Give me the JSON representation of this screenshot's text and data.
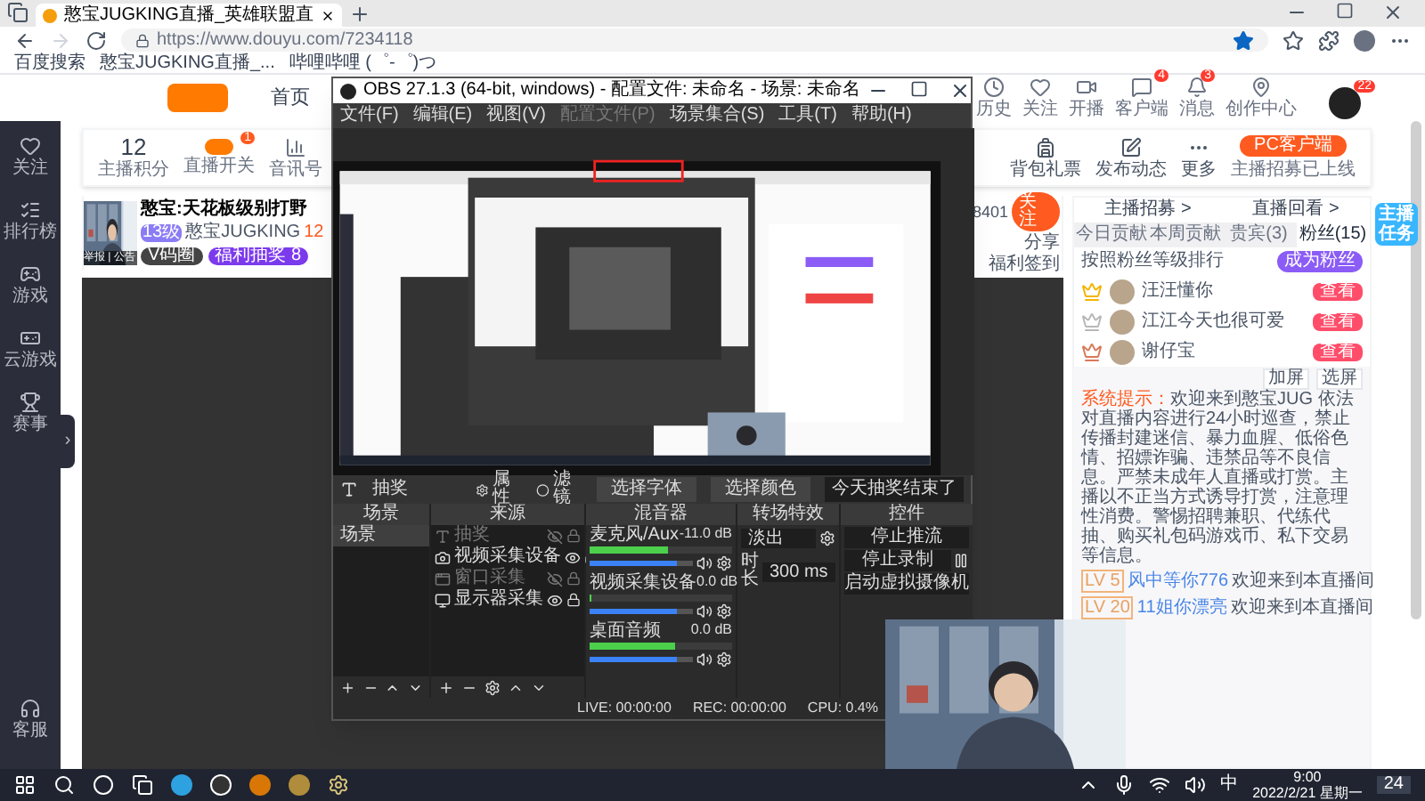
{
  "browser": {
    "tab_title": "憨宝JUGKING直播_英雄联盟直",
    "url": "https://www.douyu.com/7234118",
    "bookmarks": [
      "百度搜索",
      "憨宝JUGKING直播_...",
      "哔哩哔哩 (゜-゜)つ"
    ]
  },
  "sidebar": {
    "items": [
      "关注",
      "排行榜",
      "游戏",
      "云游戏",
      "赛事"
    ],
    "bottom": "客服",
    "toggle": "›"
  },
  "header": {
    "nav": "首页",
    "icons": [
      {
        "label": "历史"
      },
      {
        "label": "关注"
      },
      {
        "label": "开播"
      },
      {
        "label": "客户端",
        "badge": "4"
      },
      {
        "label": "消息",
        "badge": "3"
      },
      {
        "label": "创作中心"
      }
    ],
    "avatar_badge": "22"
  },
  "stats": {
    "score": "12",
    "score_label": "主播积分",
    "switch_label": "直播开关",
    "switch_badge": "1",
    "signal_label": "音讯号",
    "tools": [
      "背包礼票",
      "发布动态",
      "更多"
    ],
    "pc_button": "PC客户端",
    "pc_note": "主播招募已上线"
  },
  "streamer": {
    "thumb_overlay": "举报 | 公告",
    "title": "憨宝:天花板级别打野",
    "level": "13级",
    "name": "憨宝JUGKING",
    "heat": "12",
    "tags": [
      "V码圈",
      "福利抽奖 8"
    ],
    "followers": "8401",
    "follow_button": "关注",
    "share": "分享",
    "sign": "福利签到"
  },
  "panel": {
    "links": [
      "主播招募 >",
      "直播回看 >"
    ],
    "tabs": [
      {
        "label": "今日贡献",
        "selected": false
      },
      {
        "label": "本周贡献",
        "selected": false
      },
      {
        "label": "贵宾(3)",
        "selected": false
      },
      {
        "label": "粉丝(15)",
        "selected": true
      }
    ],
    "rank_title": "按照粉丝等级排行",
    "join_button": "成为粉丝",
    "fans": [
      {
        "name": "汪汪懂你",
        "badge": "查看"
      },
      {
        "name": "江江今天也很可爱",
        "badge": "查看"
      },
      {
        "name": "谢仔宝",
        "badge": "查看"
      }
    ],
    "system_label": "系统提示：",
    "system_text": "欢迎来到憨宝JUG 依法对直播内容进行24小时巡查，禁止传播封建迷信、暴力血腥、低俗色情、招嫖诈骗、违禁品等不良信息。严禁未成年人直播或打赏。主播以不正当方式诱导打赏，注意理性消费。警惕招聘兼职、代练代抽、购买礼包码游戏币、私下交易等信息。",
    "chat_tools": [
      "加屏",
      "选屏"
    ],
    "messages": [
      {
        "level": "LV 5",
        "name": "风中等你776",
        "text": "欢迎来到本直播间"
      },
      {
        "level": "LV 20",
        "name": "11姐你漂亮",
        "text": "欢迎来到本直播间"
      }
    ]
  },
  "sticker": "主播任务",
  "obs": {
    "title": "OBS 27.1.3 (64-bit, windows) - 配置文件: 未命名 - 场景: 未命名",
    "menu": [
      {
        "label": "文件(F)",
        "disabled": false
      },
      {
        "label": "编辑(E)",
        "disabled": false
      },
      {
        "label": "视图(V)",
        "disabled": false
      },
      {
        "label": "配置文件(P)",
        "disabled": true
      },
      {
        "label": "场景集合(S)",
        "disabled": false
      },
      {
        "label": "工具(T)",
        "disabled": false
      },
      {
        "label": "帮助(H)",
        "disabled": false
      }
    ],
    "toolbar": {
      "source": "抽奖",
      "buttons": [
        "属性",
        "滤镜"
      ],
      "font_button": "选择字体",
      "color_button": "选择颜色",
      "text": "今天抽奖结束了"
    },
    "docks": [
      "场景",
      "来源",
      "混音器",
      "转场特效",
      "控件"
    ],
    "scenes": [
      {
        "name": "场景",
        "selected": true
      }
    ],
    "sources": [
      {
        "kind": "text",
        "name": "抽奖",
        "visible": false
      },
      {
        "kind": "camera",
        "name": "视频采集设备",
        "visible": true
      },
      {
        "kind": "window",
        "name": "窗口采集",
        "visible": false
      },
      {
        "kind": "display",
        "name": "显示器采集",
        "visible": true
      }
    ],
    "mixer": [
      {
        "name": "麦克风/Aux",
        "reading": "-11.0 dB",
        "meter": {
          "level": 0.55
        },
        "volume": {
          "level": 0.85
        }
      },
      {
        "name": "视频采集设备",
        "reading": "0.0 dB",
        "meter": {
          "level": 0
        },
        "volume": {
          "level": 0.85
        }
      },
      {
        "name": "桌面音频",
        "reading": "0.0 dB",
        "meter": {
          "level": 0.6
        },
        "volume": {
          "level": 0.85
        }
      }
    ],
    "transition": {
      "value": "淡出",
      "duration_label": "时长",
      "duration": "300 ms"
    },
    "controls": [
      "停止推流",
      "停止录制",
      "启动虚拟摄像机"
    ],
    "status": {
      "live": "LIVE: 00:00:00",
      "rec": "REC: 00:00:00",
      "cpu": "CPU: 0.4%"
    }
  },
  "taskbar": {
    "ime": "中",
    "time": "9:00",
    "date": "2022/2/21 星期一",
    "notifications": "24"
  }
}
